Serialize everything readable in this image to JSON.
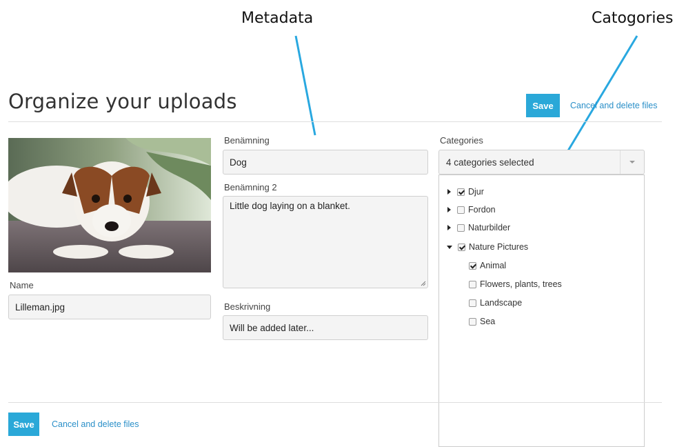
{
  "annotations": {
    "metadata": "Metadata",
    "categories": "Catogories"
  },
  "page": {
    "title": "Organize your uploads"
  },
  "header": {
    "save_label": "Save",
    "cancel_label": "Cancel and delete files"
  },
  "footer": {
    "save_label": "Save",
    "cancel_label": "Cancel and delete files"
  },
  "file": {
    "name_label": "Name",
    "name_value": "Lilleman.jpg"
  },
  "metadata": {
    "benamning_label": "Benämning",
    "benamning_value": "Dog",
    "benamning2_label": "Benämning 2",
    "benamning2_value": "Little dog laying on a blanket.",
    "beskrivning_label": "Beskrivning",
    "beskrivning_value": "Will be added later..."
  },
  "categories": {
    "label": "Categories",
    "selected_text": "4 categories selected",
    "tree": [
      {
        "label": "Djur",
        "checked": true,
        "expanded": false
      },
      {
        "label": "Fordon",
        "checked": false,
        "expanded": false
      },
      {
        "label": "Naturbilder",
        "checked": false,
        "expanded": false
      },
      {
        "label": "Nature Pictures",
        "checked": true,
        "expanded": true,
        "children": [
          {
            "label": "Animal",
            "checked": true
          },
          {
            "label": "Flowers, plants, trees",
            "checked": false
          },
          {
            "label": "Landscape",
            "checked": false
          },
          {
            "label": "Sea",
            "checked": false
          }
        ]
      }
    ]
  },
  "colors": {
    "accent": "#2aa8d8",
    "link": "#2a8fc8"
  },
  "icons": {
    "photo": "dog-photo",
    "expand": "triangle-right-icon",
    "collapse": "triangle-down-icon",
    "dropdown": "chevron-down-icon"
  }
}
